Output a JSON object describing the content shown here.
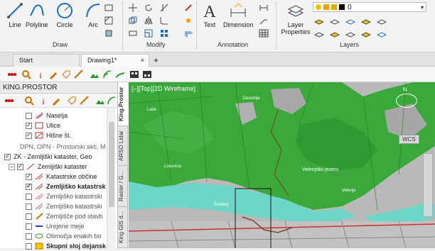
{
  "ribbon": {
    "draw_tools": [
      "Line",
      "Polyline",
      "Circle",
      "Arc"
    ],
    "panel_draw": "Draw",
    "panel_modify": "Modify",
    "annotation_tools": [
      "Text",
      "Dimension"
    ],
    "panel_annotation": "Annotation",
    "layer_properties": "Layer Properties",
    "panel_layers": "Layers",
    "layer_current": "0"
  },
  "tabs": [
    "Start",
    "Drawing1*"
  ],
  "left_panel": {
    "title": "KING.PROSTOR",
    "tree": [
      {
        "label": "Naselja",
        "checked": false
      },
      {
        "label": "Ulice",
        "checked": true
      },
      {
        "label": "Hišne št.",
        "checked": true
      },
      {
        "label": "DPN, OPN - Prostorski akti, M",
        "checked": null
      },
      {
        "label": "ZK - Zemljiški kataster, Geo",
        "checked": true
      },
      {
        "label": "Zemljiški kataster",
        "checked": true
      },
      {
        "label": "Katastrske občine",
        "checked": true
      },
      {
        "label": "Zemljiško katastrsk",
        "checked": true
      },
      {
        "label": "Zemljiško katastrski",
        "checked": false
      },
      {
        "label": "Zemljiško katastrski",
        "checked": false
      },
      {
        "label": "Zemljišče pod stavb",
        "checked": false
      },
      {
        "label": "Urejene meje",
        "checked": false
      },
      {
        "label": "Območja enakih bo",
        "checked": false
      },
      {
        "label": "Skupni sloj dejansk",
        "checked": false
      }
    ]
  },
  "side_tabs": [
    "King.Prostor",
    "ARSO Lidar",
    "Raster / G...",
    "King GIS d..."
  ],
  "map": {
    "view_label": "[–][Top][2D Wireframe]",
    "wcs": "WCS",
    "compass_n": "N",
    "lake_label": "Velenjsko jezero",
    "small_labels": [
      "Laše",
      "Lokovica",
      "Velenje",
      "Zavodnje",
      "Šoštanj"
    ]
  },
  "colors": {
    "vegetation": "#3aa83a",
    "water": "#6ed6c8",
    "ground": "#b9b9b9"
  }
}
